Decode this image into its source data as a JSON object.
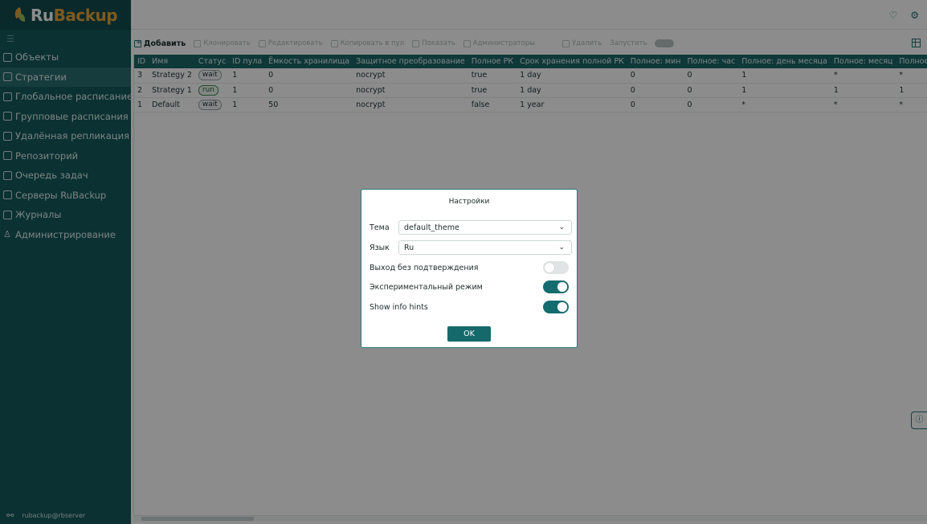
{
  "app": {
    "logo_ru": "Ru",
    "logo_backup": "Backup"
  },
  "sidebar": {
    "items": [
      {
        "label": "Объекты",
        "icon": "monitor-icon"
      },
      {
        "label": "Стратегии",
        "icon": "document-icon",
        "active": true
      },
      {
        "label": "Глобальное расписание",
        "icon": "calendar-icon"
      },
      {
        "label": "Групповые расписания",
        "icon": "group-calendar-icon"
      },
      {
        "label": "Удалённая репликация",
        "icon": "replication-icon"
      },
      {
        "label": "Репозиторий",
        "icon": "repository-icon"
      },
      {
        "label": "Очередь задач",
        "icon": "queue-icon"
      },
      {
        "label": "Серверы RuBackup",
        "icon": "server-icon"
      },
      {
        "label": "Журналы",
        "icon": "log-icon"
      },
      {
        "label": "Администрирование",
        "icon": "admin-icon"
      }
    ],
    "user": "rubackup@rbserver"
  },
  "toolbar": {
    "add": "Добавить",
    "copy": "Клонировать",
    "edit": "Редактировать",
    "copy_to_pool": "Копировать в пул",
    "show": "Показать",
    "admins": "Администраторы",
    "delete": "Удалить",
    "run": "Запустить"
  },
  "table": {
    "headers": [
      "ID",
      "Имя",
      "Статус",
      "ID пула",
      "Ёмкость хранилища",
      "Защитное преобразование",
      "Полное РК",
      "Срок хранения полной РК",
      "Полное: мин",
      "Полное: час",
      "Полное: день месяца",
      "Полное: месяц",
      "Полное: день не"
    ],
    "rows": [
      [
        "3",
        "Strategy 2",
        "wait",
        "1",
        "0",
        "nocrypt",
        "true",
        "1 day",
        "0",
        "0",
        "1",
        "*",
        "*"
      ],
      [
        "2",
        "Strategy 1",
        "run",
        "1",
        "0",
        "nocrypt",
        "true",
        "1 day",
        "0",
        "0",
        "1",
        "1",
        "1"
      ],
      [
        "1",
        "Default",
        "wait",
        "1",
        "50",
        "nocrypt",
        "false",
        "1 year",
        "0",
        "0",
        "*",
        "*",
        "*"
      ]
    ]
  },
  "dialog": {
    "title": "Настройки",
    "theme_label": "Тема",
    "theme_value": "default_theme",
    "lang_label": "Язык",
    "lang_value": "Ru",
    "exit_label": "Выход без подтверждения",
    "exit_on": false,
    "experimental_label": "Экспериментальный режим",
    "experimental_on": true,
    "hints_label": "Show info hints",
    "hints_on": true,
    "ok": "OK"
  },
  "colors": {
    "sidebar": "#145a5c",
    "accent": "#16696b",
    "header": "#1d6668"
  }
}
